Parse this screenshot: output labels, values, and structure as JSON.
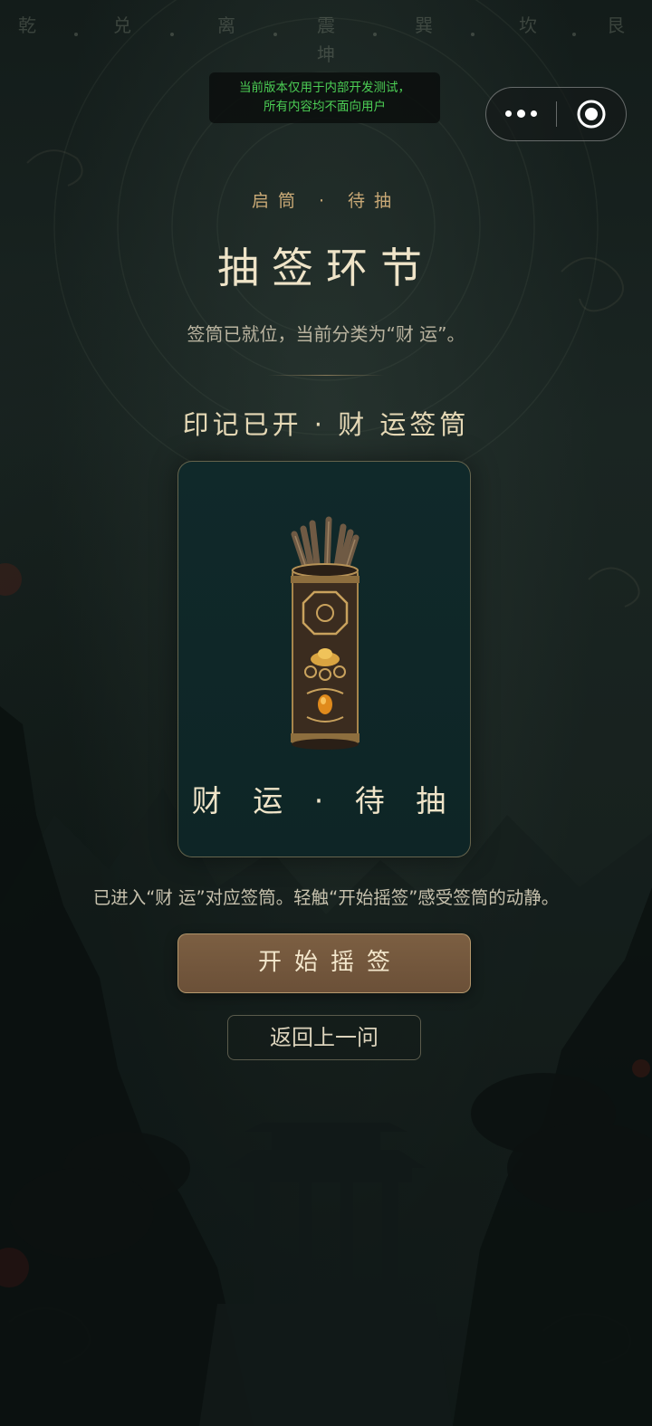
{
  "top_trigrams": [
    "乾",
    "兑",
    "离",
    "震",
    "巽",
    "坎",
    "艮"
  ],
  "bottom_trigram": "坤",
  "dev_banner": {
    "line1": "当前版本仅用于内部开发测试，",
    "line2": "所有内容均不面向用户"
  },
  "capsule": {
    "more_icon": "more-dots-icon",
    "close_icon": "target-circle-icon"
  },
  "header": {
    "eyebrow": "启筒 · 待抽",
    "title": "抽签环节",
    "subtitle": "签筒已就位，当前分类为“财 运”。"
  },
  "seal_line": "印记已开 · 财 运签筒",
  "card": {
    "image": "fortune-stick-tube",
    "label": "财 运 · 待 抽"
  },
  "hint": "已进入“财 运”对应签筒。轻触“开始摇签”感受签筒的动静。",
  "actions": {
    "primary": "开始摇签",
    "secondary": "返回上一问"
  },
  "colors": {
    "accent_gold": "#c9a976",
    "button_bronze": "#7c5f42",
    "card_teal": "#10292a",
    "dev_green": "#4ccf55"
  }
}
